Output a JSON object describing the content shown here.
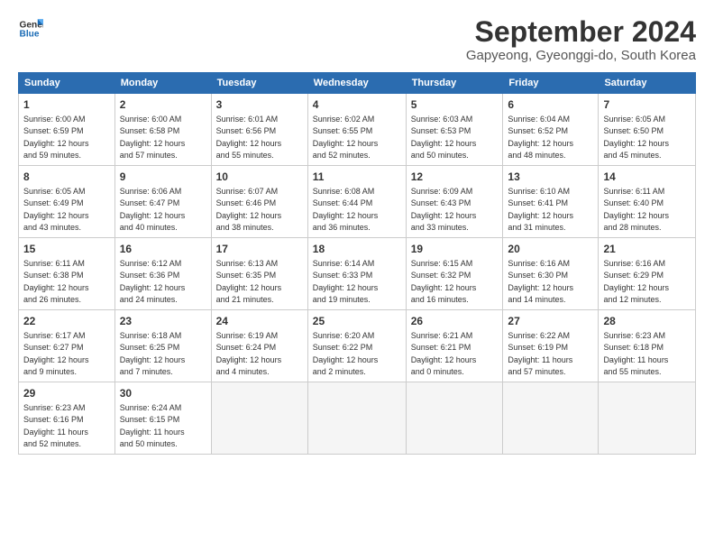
{
  "logo": {
    "line1": "General",
    "line2": "Blue"
  },
  "title": "September 2024",
  "subtitle": "Gapyeong, Gyeonggi-do, South Korea",
  "headers": [
    "Sunday",
    "Monday",
    "Tuesday",
    "Wednesday",
    "Thursday",
    "Friday",
    "Saturday"
  ],
  "weeks": [
    [
      {
        "day": "1",
        "info": "Sunrise: 6:00 AM\nSunset: 6:59 PM\nDaylight: 12 hours\nand 59 minutes."
      },
      {
        "day": "2",
        "info": "Sunrise: 6:00 AM\nSunset: 6:58 PM\nDaylight: 12 hours\nand 57 minutes."
      },
      {
        "day": "3",
        "info": "Sunrise: 6:01 AM\nSunset: 6:56 PM\nDaylight: 12 hours\nand 55 minutes."
      },
      {
        "day": "4",
        "info": "Sunrise: 6:02 AM\nSunset: 6:55 PM\nDaylight: 12 hours\nand 52 minutes."
      },
      {
        "day": "5",
        "info": "Sunrise: 6:03 AM\nSunset: 6:53 PM\nDaylight: 12 hours\nand 50 minutes."
      },
      {
        "day": "6",
        "info": "Sunrise: 6:04 AM\nSunset: 6:52 PM\nDaylight: 12 hours\nand 48 minutes."
      },
      {
        "day": "7",
        "info": "Sunrise: 6:05 AM\nSunset: 6:50 PM\nDaylight: 12 hours\nand 45 minutes."
      }
    ],
    [
      {
        "day": "8",
        "info": "Sunrise: 6:05 AM\nSunset: 6:49 PM\nDaylight: 12 hours\nand 43 minutes."
      },
      {
        "day": "9",
        "info": "Sunrise: 6:06 AM\nSunset: 6:47 PM\nDaylight: 12 hours\nand 40 minutes."
      },
      {
        "day": "10",
        "info": "Sunrise: 6:07 AM\nSunset: 6:46 PM\nDaylight: 12 hours\nand 38 minutes."
      },
      {
        "day": "11",
        "info": "Sunrise: 6:08 AM\nSunset: 6:44 PM\nDaylight: 12 hours\nand 36 minutes."
      },
      {
        "day": "12",
        "info": "Sunrise: 6:09 AM\nSunset: 6:43 PM\nDaylight: 12 hours\nand 33 minutes."
      },
      {
        "day": "13",
        "info": "Sunrise: 6:10 AM\nSunset: 6:41 PM\nDaylight: 12 hours\nand 31 minutes."
      },
      {
        "day": "14",
        "info": "Sunrise: 6:11 AM\nSunset: 6:40 PM\nDaylight: 12 hours\nand 28 minutes."
      }
    ],
    [
      {
        "day": "15",
        "info": "Sunrise: 6:11 AM\nSunset: 6:38 PM\nDaylight: 12 hours\nand 26 minutes."
      },
      {
        "day": "16",
        "info": "Sunrise: 6:12 AM\nSunset: 6:36 PM\nDaylight: 12 hours\nand 24 minutes."
      },
      {
        "day": "17",
        "info": "Sunrise: 6:13 AM\nSunset: 6:35 PM\nDaylight: 12 hours\nand 21 minutes."
      },
      {
        "day": "18",
        "info": "Sunrise: 6:14 AM\nSunset: 6:33 PM\nDaylight: 12 hours\nand 19 minutes."
      },
      {
        "day": "19",
        "info": "Sunrise: 6:15 AM\nSunset: 6:32 PM\nDaylight: 12 hours\nand 16 minutes."
      },
      {
        "day": "20",
        "info": "Sunrise: 6:16 AM\nSunset: 6:30 PM\nDaylight: 12 hours\nand 14 minutes."
      },
      {
        "day": "21",
        "info": "Sunrise: 6:16 AM\nSunset: 6:29 PM\nDaylight: 12 hours\nand 12 minutes."
      }
    ],
    [
      {
        "day": "22",
        "info": "Sunrise: 6:17 AM\nSunset: 6:27 PM\nDaylight: 12 hours\nand 9 minutes."
      },
      {
        "day": "23",
        "info": "Sunrise: 6:18 AM\nSunset: 6:25 PM\nDaylight: 12 hours\nand 7 minutes."
      },
      {
        "day": "24",
        "info": "Sunrise: 6:19 AM\nSunset: 6:24 PM\nDaylight: 12 hours\nand 4 minutes."
      },
      {
        "day": "25",
        "info": "Sunrise: 6:20 AM\nSunset: 6:22 PM\nDaylight: 12 hours\nand 2 minutes."
      },
      {
        "day": "26",
        "info": "Sunrise: 6:21 AM\nSunset: 6:21 PM\nDaylight: 12 hours\nand 0 minutes."
      },
      {
        "day": "27",
        "info": "Sunrise: 6:22 AM\nSunset: 6:19 PM\nDaylight: 11 hours\nand 57 minutes."
      },
      {
        "day": "28",
        "info": "Sunrise: 6:23 AM\nSunset: 6:18 PM\nDaylight: 11 hours\nand 55 minutes."
      }
    ],
    [
      {
        "day": "29",
        "info": "Sunrise: 6:23 AM\nSunset: 6:16 PM\nDaylight: 11 hours\nand 52 minutes."
      },
      {
        "day": "30",
        "info": "Sunrise: 6:24 AM\nSunset: 6:15 PM\nDaylight: 11 hours\nand 50 minutes."
      },
      {
        "day": "",
        "info": ""
      },
      {
        "day": "",
        "info": ""
      },
      {
        "day": "",
        "info": ""
      },
      {
        "day": "",
        "info": ""
      },
      {
        "day": "",
        "info": ""
      }
    ]
  ]
}
